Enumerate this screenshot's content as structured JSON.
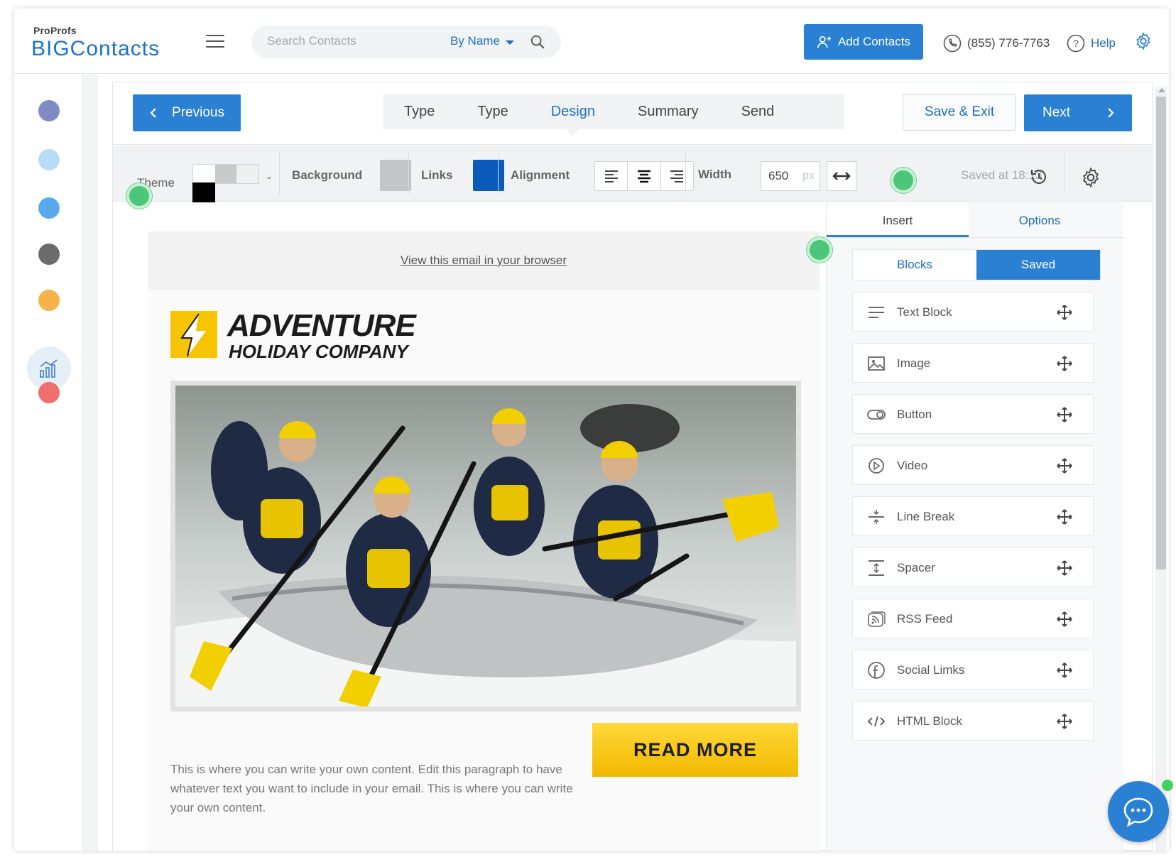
{
  "brand": {
    "top": "ProProfs",
    "main": "BIGContacts"
  },
  "header": {
    "search_placeholder": "Search Contacts",
    "search_by": "By Name",
    "add_contacts": "Add Contacts",
    "phone": "(855) 776-7763",
    "help": "Help"
  },
  "rail": {
    "dot_colors": [
      "#7e8cc4",
      "#b9dcf7",
      "#5aa9ef",
      "#6b6b6b",
      "#f7b24a",
      "#ef6f6f"
    ]
  },
  "nav": {
    "previous": "Previous",
    "next": "Next",
    "save_exit": "Save & Exit",
    "steps": [
      "Type",
      "Type",
      "Design",
      "Summary",
      "Send"
    ],
    "active_step": "Design"
  },
  "toolbar": {
    "theme_label": "Theme",
    "background_label": "Background",
    "background_color": "#c4c5c7",
    "links_label": "Links",
    "links_color": "#0b5cba",
    "alignment_label": "Alignment",
    "width_label": "Width",
    "width_value": "650",
    "width_unit": "px",
    "saved_text": "Saved at 18:13"
  },
  "email": {
    "view_in_browser": "View this email in your browser",
    "logo_title": "ADVENTURE",
    "logo_subtitle": "HOLIDAY COMPANY",
    "read_more": "READ MORE",
    "body_text": "This is where you can write your own content. Edit this paragraph to have whatever text you want to include in your email. This is where you can write your own content."
  },
  "panel": {
    "tabs": [
      "Insert",
      "Options"
    ],
    "segments": [
      "Blocks",
      "Saved"
    ],
    "blocks": [
      {
        "label": "Text Block",
        "icon": "text-block-icon"
      },
      {
        "label": "Image",
        "icon": "image-icon"
      },
      {
        "label": "Button",
        "icon": "button-toggle-icon"
      },
      {
        "label": "Video",
        "icon": "video-play-icon"
      },
      {
        "label": "Line Break",
        "icon": "line-break-icon"
      },
      {
        "label": "Spacer",
        "icon": "spacer-icon"
      },
      {
        "label": "RSS Feed",
        "icon": "rss-feed-icon"
      },
      {
        "label": "Social Limks",
        "icon": "facebook-icon"
      },
      {
        "label": "HTML Block",
        "icon": "code-icon"
      }
    ]
  }
}
